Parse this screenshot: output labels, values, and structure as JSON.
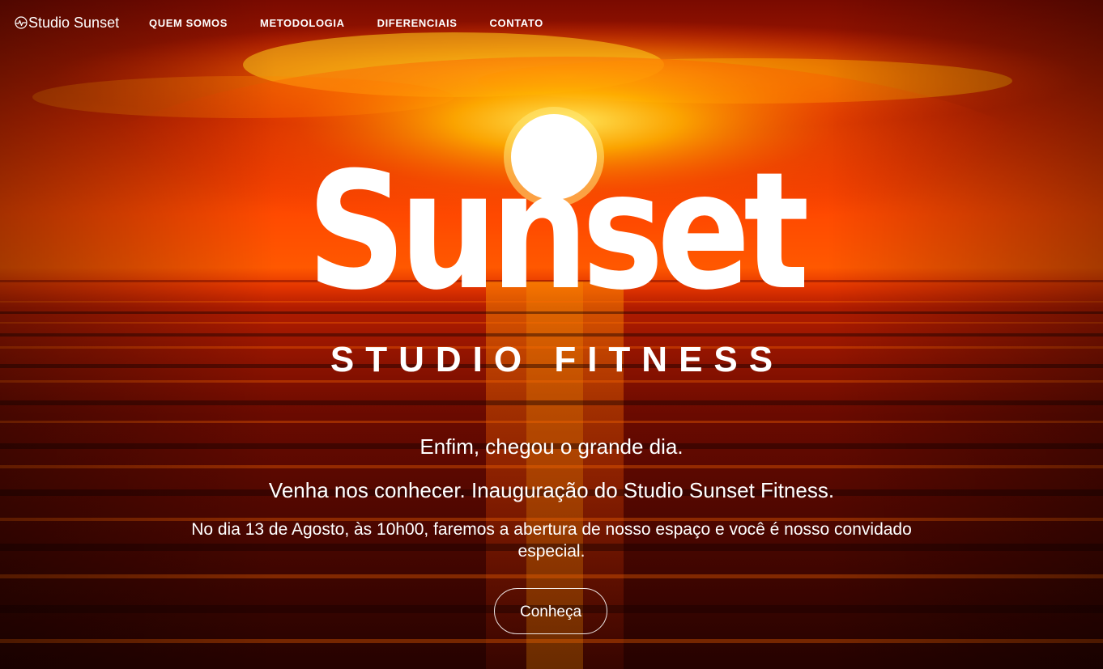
{
  "nav": {
    "brand_label": "Studio Sunset",
    "brand_icon": "heartbeat-icon",
    "items": [
      {
        "label": "QUEM SOMOS"
      },
      {
        "label": "METODOLOGIA"
      },
      {
        "label": "DIFERENCIAIS"
      },
      {
        "label": "CONTATO"
      }
    ]
  },
  "hero": {
    "logo_word": "Sunset",
    "logo_subtitle": "STUDIO FITNESS",
    "headline": "Enfim, chegou o grande dia.",
    "subheadline": "Venha nos conhecer. Inauguração do Studio Sunset Fitness.",
    "body": "No dia 13 de Agosto, às 10h00, faremos a abertura de nosso espaço e você é nosso convidado especial.",
    "cta_label": "Conheça"
  },
  "colors": {
    "text": "#ffffff",
    "sky_orange": "#ff5a00",
    "sky_deep": "#8a0e00",
    "sun_glow": "#ffd23a",
    "sea": "#3a0600"
  }
}
